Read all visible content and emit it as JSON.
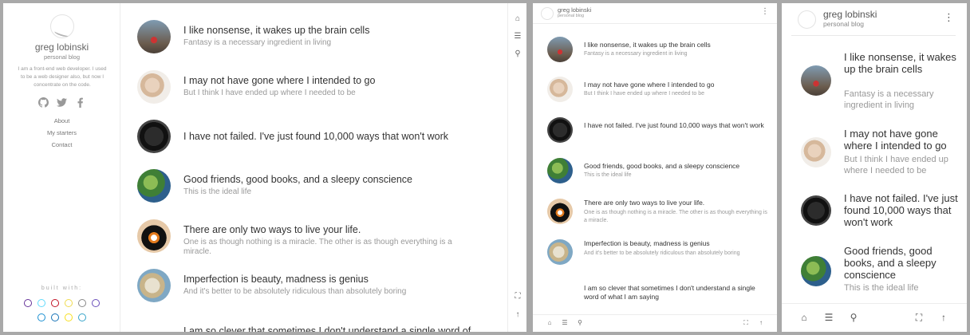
{
  "site": {
    "name": "greg lobinski",
    "subtitle": "personal blog",
    "bio": "I am a front-end web developer. I used to be a web designer also, but now I concentrate on the code."
  },
  "social": [
    {
      "icon": "github-icon"
    },
    {
      "icon": "twitter-icon"
    },
    {
      "icon": "facebook-icon"
    }
  ],
  "nav": [
    "About",
    "My starters",
    "Contact"
  ],
  "built_with": {
    "title": "built with:",
    "row1_colors": [
      "#663399",
      "#61dafb",
      "#c21325",
      "#f0db4f",
      "#888888",
      "#6b4fbb"
    ],
    "row2_colors": [
      "#1a8fd1",
      "#1572b6",
      "#f7df1e",
      "#35a3c9"
    ]
  },
  "posts": [
    {
      "title": "I like nonsense, it wakes up the brain cells",
      "subtitle": "Fantasy is a necessary ingredient in living",
      "thumb": "t1"
    },
    {
      "title": "I may not have gone where I intended to go",
      "subtitle": "But I think I have ended up where I needed to be",
      "thumb": "t2"
    },
    {
      "title": "I have not failed. I've just found 10,000 ways that won't work",
      "subtitle": "",
      "thumb": "t3"
    },
    {
      "title": "Good friends, good books, and a sleepy conscience",
      "subtitle": "This is the ideal life",
      "thumb": "t4"
    },
    {
      "title": "There are only two ways to live your life.",
      "subtitle": "One is as though nothing is a miracle. The other is as though everything is a miracle.",
      "thumb": "t5"
    },
    {
      "title": "Imperfection is beauty, madness is genius",
      "subtitle": "And it's better to be absolutely ridiculous than absolutely boring",
      "thumb": "t6"
    },
    {
      "title": "I am so clever that sometimes I don't understand a single word of what I am saying",
      "subtitle": "",
      "thumb": "t7"
    }
  ],
  "desktop": {
    "last_post_title": "I am so clever that sometimes I don't understand a single word of"
  },
  "icons": {
    "home": "⌂",
    "filter": "☰",
    "search": "⚲",
    "fullscreen": "⛶",
    "up": "↑",
    "menu": "⋮"
  }
}
